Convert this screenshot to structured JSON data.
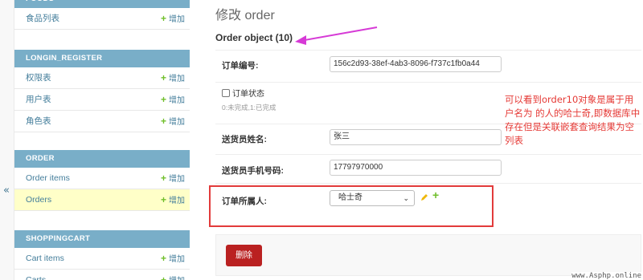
{
  "sidebar": {
    "collapse_glyph": "«",
    "modules": [
      {
        "caption": "FOODS",
        "rows": [
          {
            "label": "食品列表",
            "add": "增加",
            "current": false
          }
        ]
      },
      {
        "caption": "LONGIN_REGISTER",
        "rows": [
          {
            "label": "权限表",
            "add": "增加",
            "current": false
          },
          {
            "label": "用户表",
            "add": "增加",
            "current": false
          },
          {
            "label": "角色表",
            "add": "增加",
            "current": false
          }
        ]
      },
      {
        "caption": "ORDER",
        "rows": [
          {
            "label": "Order items",
            "add": "增加",
            "current": false
          },
          {
            "label": "Orders",
            "add": "增加",
            "current": true
          }
        ]
      },
      {
        "caption": "SHOPPINGCART",
        "rows": [
          {
            "label": "Cart items",
            "add": "增加",
            "current": false
          },
          {
            "label": "Carts",
            "add": "增加",
            "current": false
          }
        ]
      }
    ]
  },
  "main": {
    "title": "修改 order",
    "object_heading": "Order object (10)",
    "fields": {
      "order_number": {
        "label": "订单编号:",
        "value": "156c2d93-38ef-4ab3-8096-f737c1fb0a44"
      },
      "order_status": {
        "label": "订单状态",
        "help": "0:未完成,1:已完成",
        "checked": false
      },
      "courier_name": {
        "label": "送货员姓名:",
        "value": "张三"
      },
      "courier_phone": {
        "label": "送货员手机号码:",
        "value": "17797970000"
      },
      "order_owner": {
        "label": "订单所属人:",
        "selected": "哈士奇"
      }
    },
    "delete_label": "删除"
  },
  "annotation": {
    "text": "可以看到order10对象是属于用户名为 的人的哈士奇,即数据库中存在但是关联嵌套查询结果为空列表",
    "color": "#e53935"
  },
  "watermark": "www.Asphp.online",
  "colors": {
    "module_caption_bg": "#79aec8",
    "link": "#447e9b",
    "add_plus": "#70bf2b",
    "current_row_bg": "#ffffc8",
    "delete_button_bg": "#ba2121",
    "highlight_box": "#e23b3b",
    "arrow": "#d63ad6"
  }
}
